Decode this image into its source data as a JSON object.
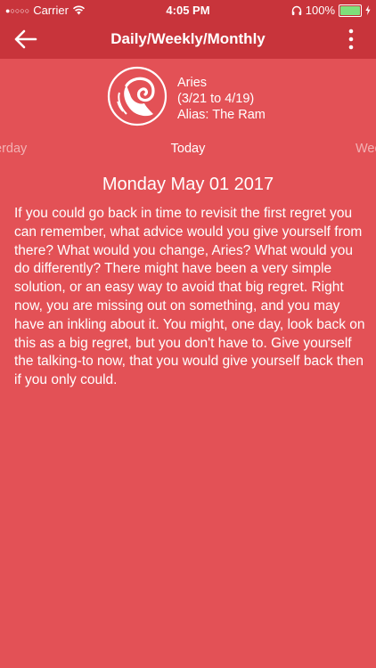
{
  "status_bar": {
    "signal_dots": "●○○○○",
    "carrier": "Carrier",
    "time": "4:05 PM",
    "battery_percent": "100%",
    "battery_level": 1.0,
    "icons": [
      "wifi-icon",
      "headphones-icon",
      "battery-icon",
      "charging-icon"
    ]
  },
  "nav": {
    "title": "Daily/Weekly/Monthly",
    "back_icon": "back-arrow-icon",
    "more_icon": "more-vertical-icon"
  },
  "sign": {
    "name": "Aries",
    "dates": "(3/21 to 4/19)",
    "alias": "Alias: The Ram",
    "logo_icon": "aries-ram-icon"
  },
  "tabs": {
    "prev": "erday",
    "current": "Today",
    "next": "Wee"
  },
  "horoscope": {
    "date": "Monday May 01 2017",
    "text": "If you could go back in time to revisit the first regret you can remember, what advice would you give yourself from there? What would you change, Aries? What would you do differently? There might have been a very simple solution, or an easy way to avoid that big regret. Right now, you are missing out on something, and you may have an inkling about it. You might, one day, look back on this as a big regret, but you don't have to. Give yourself the talking-to now, that you would give yourself back then if you only could."
  },
  "colors": {
    "background": "#e35156",
    "bar": "#c8343b",
    "battery": "#7fe07a"
  }
}
